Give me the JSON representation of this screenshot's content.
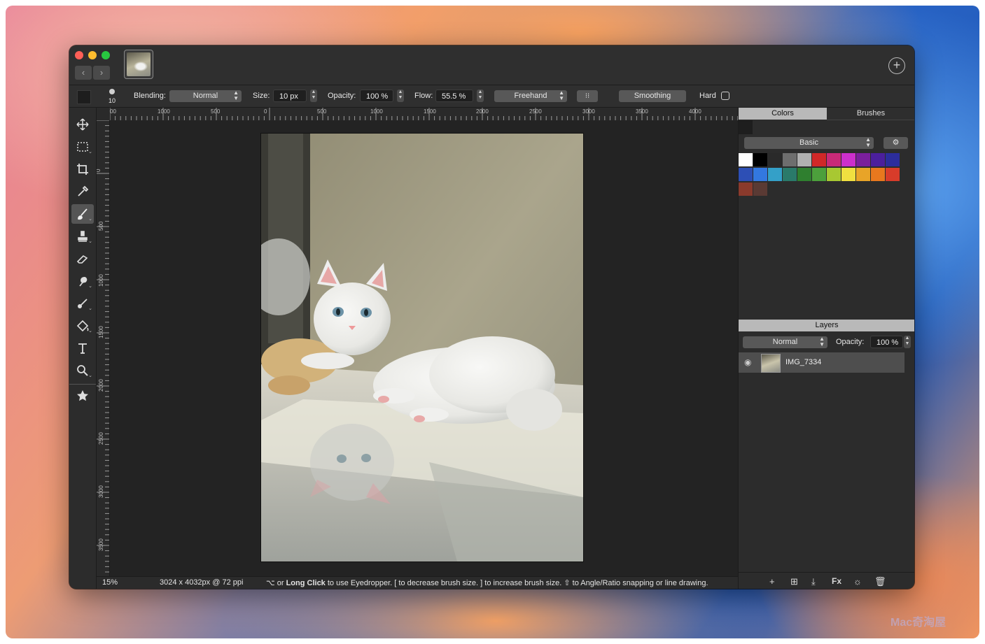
{
  "window": {
    "thumbnail_alt": "cat photo thumbnail"
  },
  "options": {
    "brush_size_indicator": "10",
    "blending_label": "Blending:",
    "blending_value": "Normal",
    "size_label": "Size:",
    "size_value": "10 px",
    "opacity_label": "Opacity:",
    "opacity_value": "100 %",
    "flow_label": "Flow:",
    "flow_value": "55.5 %",
    "mode_value": "Freehand",
    "smoothing_label": "Smoothing",
    "hard_label": "Hard"
  },
  "rulers": {
    "horizontal": [
      "00",
      "1000",
      "500",
      "0",
      "500",
      "1000",
      "1500",
      "2000",
      "2500",
      "3000",
      "3500",
      "4000"
    ],
    "vertical": [
      "0",
      "500",
      "1000",
      "1500",
      "2000",
      "2500",
      "3000",
      "3500",
      "4000"
    ]
  },
  "status": {
    "zoom": "15%",
    "dimensions": "3024 x 4032px @ 72 ppi",
    "hint_prefix": "⌥ or",
    "hint_bold": "Long Click",
    "hint_rest": "to use Eyedropper.  [ to decrease brush size.  ] to increase brush size.  ⇧ to Angle/Ratio snapping or line drawing."
  },
  "panel": {
    "tab_colors": "Colors",
    "tab_brushes": "Brushes",
    "palette_name": "Basic",
    "swatches": [
      "#ffffff",
      "#000000",
      "#2a2a2a",
      "#6e6e6e",
      "#b0b0b0",
      "#d02828",
      "#c82a78",
      "#cc2fcc",
      "#7a1f9c",
      "#4b1f9c",
      "#2c2d9c",
      "#2d4fb5",
      "#3378e0",
      "#34a0c8",
      "#2a7a6a",
      "#2f7f2f",
      "#4ca03c",
      "#a8c832",
      "#f0e040",
      "#e8a428",
      "#e8781e",
      "#d83c2a",
      "#8a3a2c",
      "#5a3a34"
    ],
    "layers_title": "Layers",
    "layer_blend": "Normal",
    "layer_opacity_label": "Opacity:",
    "layer_opacity_value": "100 %",
    "layer_name": "IMG_7334"
  },
  "watermark": "Mac奇淘屋"
}
